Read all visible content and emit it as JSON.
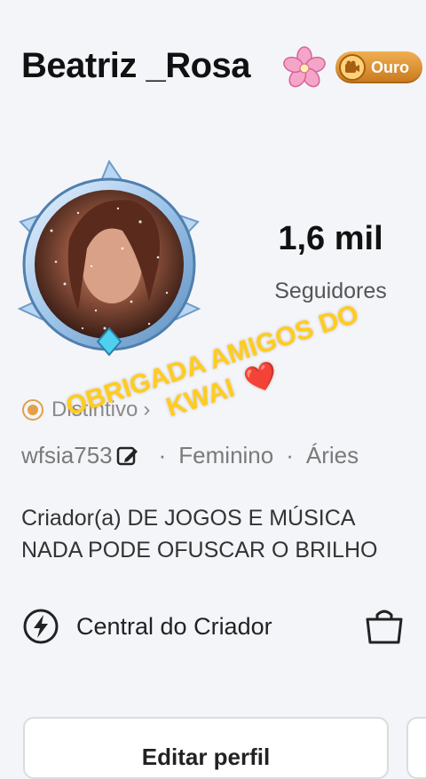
{
  "profile": {
    "name": "Beatriz _Rosa",
    "badge_label": "Ouro",
    "followers_count": "1,6 mil",
    "followers_label": "Seguidores",
    "distinction_label": "Distintivo",
    "distinction_arrow": "›",
    "user_id": "wfsia753",
    "gender": "Feminino",
    "separator": "·",
    "sign": "Áries",
    "bio_line1": "Criador(a) DE JOGOS E MÚSICA",
    "bio_line2": "NADA PODE OFUSCAR O BRILHO"
  },
  "actions": {
    "creator_center": "Central do Criador",
    "edit_profile": "Editar perfil"
  },
  "overlay": {
    "line1": "OBRIGADA AMIGOS DO",
    "line2": "KWAI",
    "heart": "❤️"
  },
  "colors": {
    "badge_gold": "#e09a3a",
    "overlay_yellow": "#ffcc1f",
    "heart_red": "#e5282e"
  },
  "icons": [
    "cherry-blossom-icon",
    "badge-camera-icon",
    "distinction-icon",
    "edit-icon",
    "lightning-icon",
    "shopping-bag-icon"
  ]
}
